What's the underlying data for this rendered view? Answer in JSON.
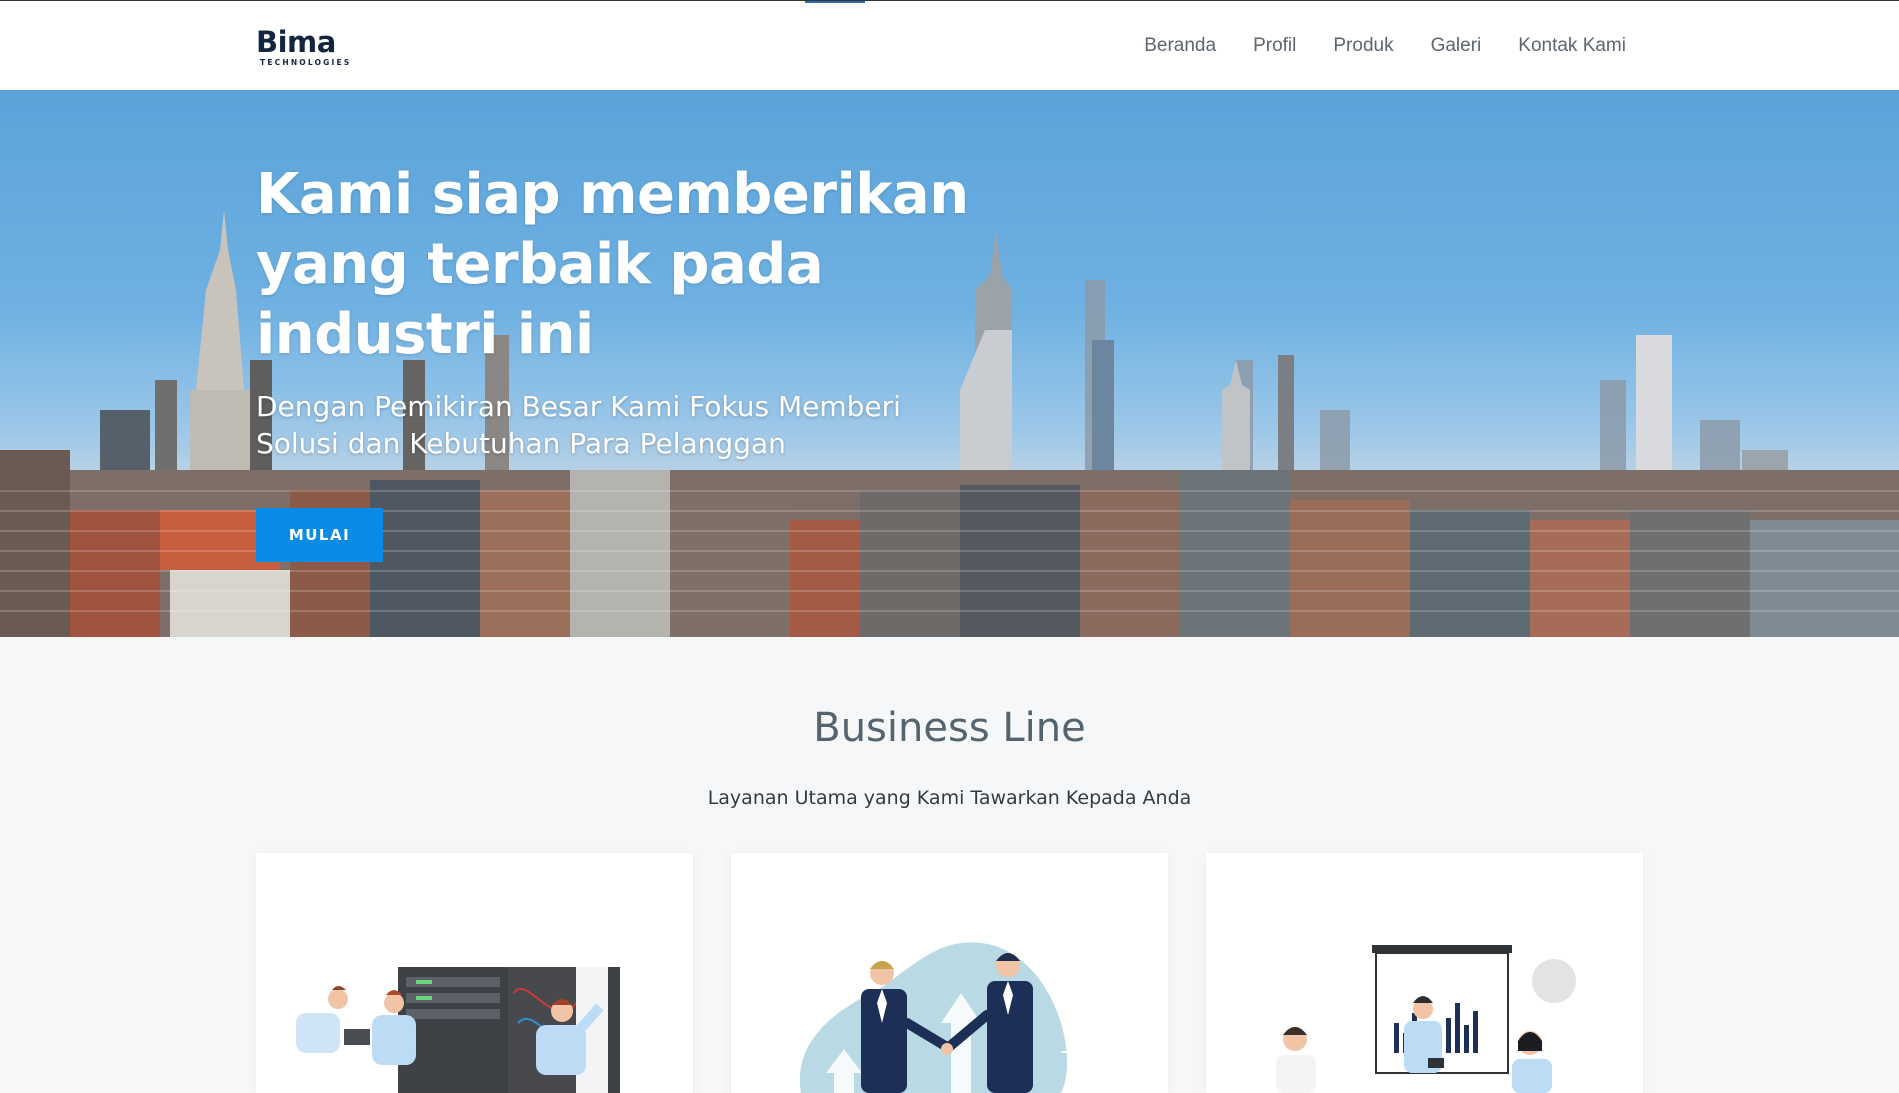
{
  "header": {
    "logo": {
      "word": "Bima",
      "sub": "TECHNOLOGIES"
    },
    "nav": [
      "Beranda",
      "Profil",
      "Produk",
      "Galeri",
      "Kontak Kami"
    ]
  },
  "hero": {
    "title_lines": [
      "Kami siap memberikan",
      "yang terbaik pada",
      "industri ini"
    ],
    "subtitle_lines": [
      "Dengan Pemikiran Besar Kami Fokus Memberi",
      "Solusi dan Kebutuhan Para Pelanggan"
    ],
    "button": "MULAI"
  },
  "business_line": {
    "title": "Business Line",
    "subtitle": "Layanan Utama yang Kami Tawarkan Kepada Anda",
    "cards": [
      {
        "illustration": "server-room-technicians-illustration"
      },
      {
        "illustration": "business-handshake-illustration"
      },
      {
        "illustration": "presentation-chart-illustration"
      }
    ]
  },
  "colors": {
    "button": "#0a8be6",
    "logo": "#14253f",
    "nav_text": "#5c6670",
    "section_title": "#55656f",
    "sky": "#5aa3da"
  }
}
